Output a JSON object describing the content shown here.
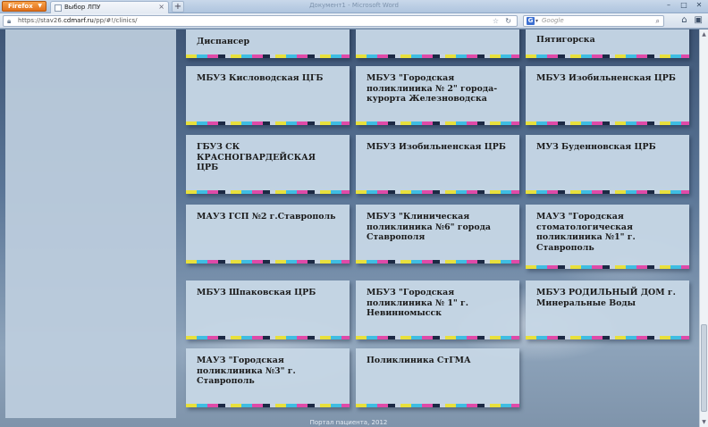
{
  "browser": {
    "app_button": "Firefox",
    "window_title": "Документ1 - Microsoft Word",
    "tab_title": "Выбор ЛПУ",
    "new_tab": "+",
    "url_prefix": "https://stav26.",
    "url_domain": "cdmarf.ru",
    "url_path": "/pp/#!/clinics/",
    "search_placeholder": "Google",
    "search_engine_letter": "G"
  },
  "page": {
    "footer": "Портал пациента, 2012"
  },
  "clinics": [
    {
      "name": "Диспансер"
    },
    {
      "name": ""
    },
    {
      "name": "Пятигорска"
    },
    {
      "name": "МБУЗ Кисловодская ЦГБ"
    },
    {
      "name": "МБУЗ \"Городская поликлиника № 2\" города-курорта Железноводска"
    },
    {
      "name": "МБУЗ Изобильненская ЦРБ"
    },
    {
      "name": "ГБУЗ СК КРАСНОГВАРДЕЙСКАЯ ЦРБ"
    },
    {
      "name": "МБУЗ Изобильненская ЦРБ"
    },
    {
      "name": "МУЗ Буденновская ЦРБ"
    },
    {
      "name": "МАУЗ ГСП №2 г.Ставрополь"
    },
    {
      "name": "МБУЗ \"Клиническая поликлиника №6\" города Ставрополя"
    },
    {
      "name": "МАУЗ \"Городская стоматологическая поликлиника №1\" г. Ставрополь"
    },
    {
      "name": "МБУЗ Шпаковская ЦРБ"
    },
    {
      "name": "МБУЗ \"Городская поликлиника № 1\" г. Невинномысск"
    },
    {
      "name": "МБУЗ РОДИЛЬНЫЙ ДОМ г. Минеральные Воды"
    },
    {
      "name": "МАУЗ \"Городская поликлиника №3\" г. Ставрополь"
    },
    {
      "name": "Поликлиника СтГМА"
    }
  ]
}
